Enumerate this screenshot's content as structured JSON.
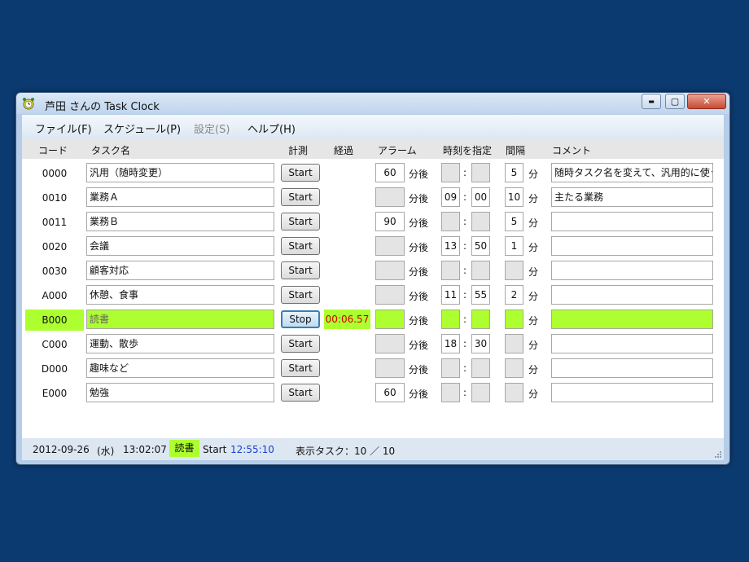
{
  "window": {
    "title": "芦田 さんの Task Clock",
    "controls": {
      "minimize": "▬",
      "maximize": "▢",
      "close": "✕"
    }
  },
  "menu": [
    "ファイル(F)",
    "スケジュール(P)",
    "設定(S)",
    "ヘルプ(H)"
  ],
  "headers": {
    "code": "コード",
    "name": "タスク名",
    "measure": "計測",
    "elapsed": "経過",
    "alarm": "アラーム",
    "time_spec": "時刻を指定",
    "interval": "間隔",
    "comment": "コメント"
  },
  "labels": {
    "after": "分後",
    "colon": ":",
    "minutes": "分"
  },
  "tasks": [
    {
      "code": "0000",
      "name": "汎用（随時変更）",
      "button": "Start",
      "elapsed": "",
      "alarm": "60",
      "hh": "",
      "mm": "",
      "interval": "5",
      "comment": "随時タスク名を変えて、汎用的に使う"
    },
    {
      "code": "0010",
      "name": "業務Ａ",
      "button": "Start",
      "elapsed": "",
      "alarm": "",
      "hh": "09",
      "mm": "00",
      "interval": "10",
      "comment": "主たる業務"
    },
    {
      "code": "0011",
      "name": "業務Ｂ",
      "button": "Start",
      "elapsed": "",
      "alarm": "90",
      "hh": "",
      "mm": "",
      "interval": "5",
      "comment": ""
    },
    {
      "code": "0020",
      "name": "会議",
      "button": "Start",
      "elapsed": "",
      "alarm": "",
      "hh": "13",
      "mm": "50",
      "interval": "1",
      "comment": ""
    },
    {
      "code": "0030",
      "name": "顧客対応",
      "button": "Start",
      "elapsed": "",
      "alarm": "",
      "hh": "",
      "mm": "",
      "interval": "",
      "comment": ""
    },
    {
      "code": "A000",
      "name": "休憩、食事",
      "button": "Start",
      "elapsed": "",
      "alarm": "",
      "hh": "11",
      "mm": "55",
      "interval": "2",
      "comment": ""
    },
    {
      "code": "B000",
      "name": "読書",
      "button": "Stop",
      "elapsed": "00:06.57",
      "alarm": "",
      "hh": "",
      "mm": "",
      "interval": "",
      "comment": ""
    },
    {
      "code": "C000",
      "name": "運動、散歩",
      "button": "Start",
      "elapsed": "",
      "alarm": "",
      "hh": "18",
      "mm": "30",
      "interval": "",
      "comment": ""
    },
    {
      "code": "D000",
      "name": "趣味など",
      "button": "Start",
      "elapsed": "",
      "alarm": "",
      "hh": "",
      "mm": "",
      "interval": "",
      "comment": ""
    },
    {
      "code": "E000",
      "name": "勉強",
      "button": "Start",
      "elapsed": "",
      "alarm": "60",
      "hh": "",
      "mm": "",
      "interval": "",
      "comment": ""
    }
  ],
  "status": {
    "date": "2012-09-26",
    "weekday": "(水)",
    "time": "13:02:07",
    "current_task": "読書",
    "start_label": "Start",
    "start_time": "12:55:10",
    "display_count": "表示タスク：10 ／ 10"
  },
  "colors": {
    "active": "#adff2f",
    "elapsed_text": "#d10000",
    "start_time": "#1a3fd1",
    "desktop": "#0b3a70"
  }
}
